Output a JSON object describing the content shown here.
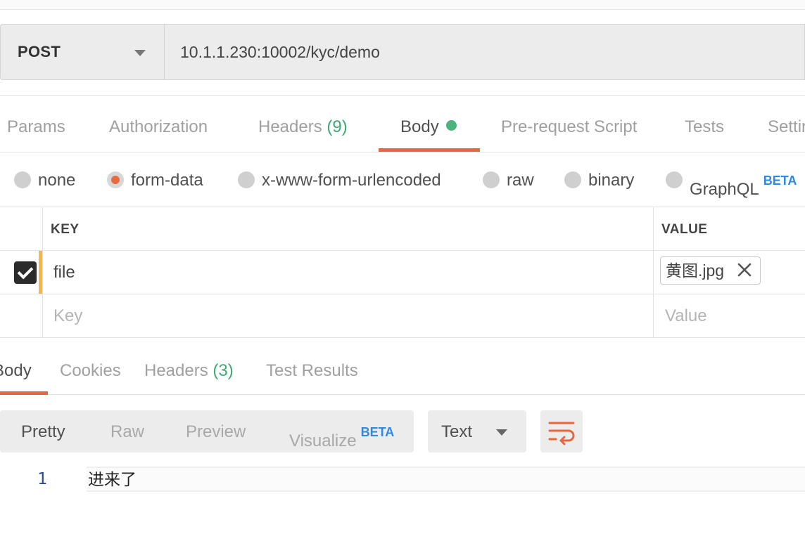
{
  "request": {
    "method": "POST",
    "url": "10.1.1.230:10002/kyc/demo"
  },
  "request_tabs": {
    "params": "Params",
    "authorization": "Authorization",
    "headers": "Headers",
    "headers_count": "(9)",
    "body": "Body",
    "prerequest": "Pre-request Script",
    "tests": "Tests",
    "settings": "Settin"
  },
  "body_types": {
    "none": "none",
    "form_data": "form-data",
    "urlencoded": "x-www-form-urlencoded",
    "raw": "raw",
    "binary": "binary",
    "graphql": "GraphQL",
    "beta": "BETA",
    "selected": "form-data"
  },
  "kv_table": {
    "key_header": "KEY",
    "value_header": "VALUE",
    "rows": [
      {
        "key": "file",
        "value": "黄图.jpg",
        "checked": true
      }
    ],
    "key_placeholder": "Key",
    "value_placeholder": "Value"
  },
  "response_tabs": {
    "body": "Body",
    "cookies": "Cookies",
    "headers": "Headers",
    "headers_count": "(3)",
    "test_results": "Test Results"
  },
  "response_view": {
    "pretty": "Pretty",
    "raw": "Raw",
    "preview": "Preview",
    "visualize": "Visualize",
    "beta": "BETA",
    "format": "Text",
    "wrap_icon": "wrap-lines-icon"
  },
  "response_body": {
    "lines": [
      {
        "number": "1",
        "text": "进来了"
      }
    ]
  },
  "colors": {
    "accent": "#e7663f",
    "count_green": "#3daa72",
    "beta_blue": "#2e8ae0",
    "row_marker": "#f4b942"
  }
}
